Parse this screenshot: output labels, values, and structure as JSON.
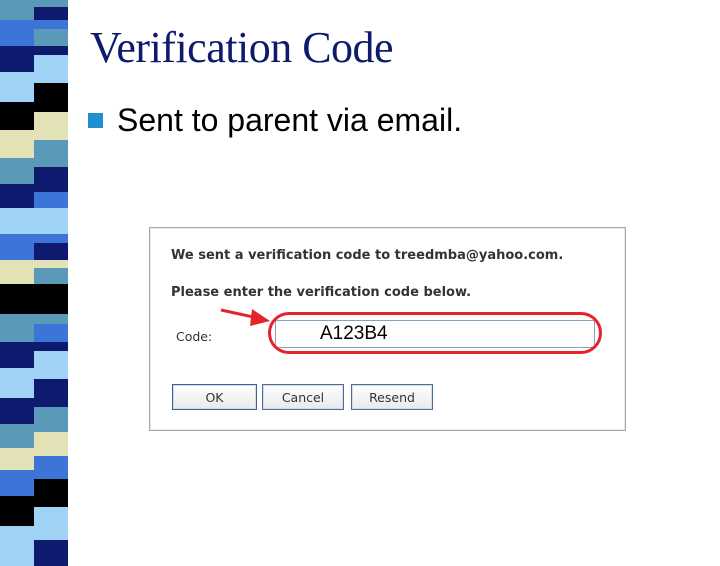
{
  "slide": {
    "title": "Verification Code",
    "bullet": "Sent to parent via email."
  },
  "dialog": {
    "message_sent": "We sent a verification code to treedmba@yahoo.com.",
    "message_enter": "Please enter the verification code below.",
    "code_label": "Code:",
    "code_value": "A123B4",
    "buttons": {
      "ok": "OK",
      "cancel": "Cancel",
      "resend": "Resend"
    }
  },
  "colors": {
    "title": "#0d1a6e",
    "bullet": "#1f8fcf",
    "highlight": "#e4242a",
    "stripe_dark": "#0d1a6e",
    "stripe_blue": "#3c74d8",
    "stripe_light": "#9fd2f4",
    "stripe_teal": "#5a9ab8",
    "stripe_cream": "#e3e2b6",
    "stripe_black": "#000000"
  },
  "icons": {
    "bullet": "square-bullet",
    "annotation": "red-arrow"
  }
}
